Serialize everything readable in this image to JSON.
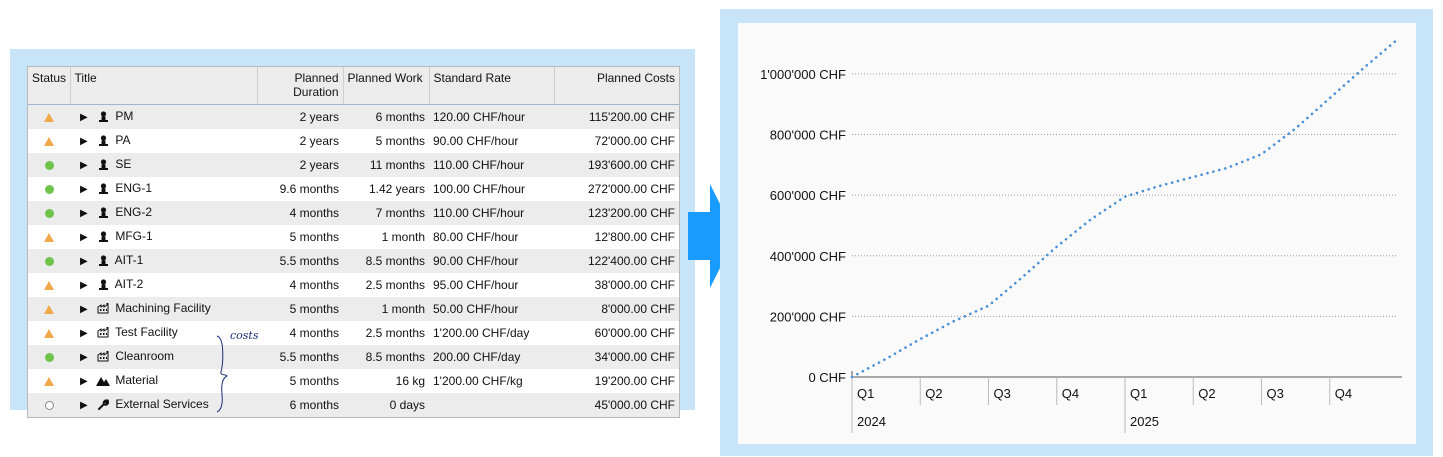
{
  "table": {
    "columns": {
      "status": "Status",
      "title": "Title",
      "planned_duration_l1": "Planned",
      "planned_duration_l2": "Duration",
      "planned_work": "Planned Work",
      "standard_rate": "Standard Rate",
      "planned_costs": "Planned Costs"
    },
    "rows": [
      {
        "status": "warning",
        "icon": "person-icon",
        "title": "PM",
        "duration": "2 years",
        "work": "6 months",
        "rate": "120.00 CHF/hour",
        "costs": "115'200.00 CHF"
      },
      {
        "status": "warning",
        "icon": "person-icon",
        "title": "PA",
        "duration": "2 years",
        "work": "5 months",
        "rate": "90.00 CHF/hour",
        "costs": "72'000.00 CHF"
      },
      {
        "status": "ok",
        "icon": "person-icon",
        "title": "SE",
        "duration": "2 years",
        "work": "11 months",
        "rate": "110.00 CHF/hour",
        "costs": "193'600.00 CHF"
      },
      {
        "status": "ok",
        "icon": "person-icon",
        "title": "ENG-1",
        "duration": "9.6 months",
        "work": "1.42 years",
        "rate": "100.00 CHF/hour",
        "costs": "272'000.00 CHF"
      },
      {
        "status": "ok",
        "icon": "person-icon",
        "title": "ENG-2",
        "duration": "4 months",
        "work": "7 months",
        "rate": "110.00 CHF/hour",
        "costs": "123'200.00 CHF"
      },
      {
        "status": "warning",
        "icon": "person-icon",
        "title": "MFG-1",
        "duration": "5 months",
        "work": "1 month",
        "rate": "80.00 CHF/hour",
        "costs": "12'800.00 CHF"
      },
      {
        "status": "ok",
        "icon": "person-icon",
        "title": "AIT-1",
        "duration": "5.5 months",
        "work": "8.5 months",
        "rate": "90.00 CHF/hour",
        "costs": "122'400.00 CHF"
      },
      {
        "status": "warning",
        "icon": "person-icon",
        "title": "AIT-2",
        "duration": "4 months",
        "work": "2.5 months",
        "rate": "95.00 CHF/hour",
        "costs": "38'000.00 CHF"
      },
      {
        "status": "warning",
        "icon": "factory-icon",
        "title": "Machining Facility",
        "duration": "5 months",
        "work": "1 month",
        "rate": "50.00 CHF/hour",
        "costs": "8'000.00 CHF"
      },
      {
        "status": "warning",
        "icon": "factory-icon",
        "title": "Test Facility",
        "duration": "4 months",
        "work": "2.5 months",
        "rate": "1'200.00 CHF/day",
        "costs": "60'000.00 CHF"
      },
      {
        "status": "ok",
        "icon": "factory-icon",
        "title": "Cleanroom",
        "duration": "5.5 months",
        "work": "8.5 months",
        "rate": "200.00 CHF/day",
        "costs": "34'000.00 CHF"
      },
      {
        "status": "warning",
        "icon": "mountain-icon",
        "title": "Material",
        "duration": "5 months",
        "work": "16 kg",
        "rate": "1'200.00 CHF/kg",
        "costs": "19'200.00 CHF"
      },
      {
        "status": "none",
        "icon": "wrench-icon",
        "title": "External Services",
        "duration": "6 months",
        "work": "0 days",
        "rate": "",
        "costs": "45'000.00 CHF"
      }
    ]
  },
  "annotation": {
    "text": "costs"
  },
  "colors": {
    "panel_bg": "#c8e4f8",
    "arrow": "#1a9bff",
    "status_warning": "#f0a94a",
    "status_ok": "#6fc24a",
    "series": "#4a90d9"
  },
  "chart_data": {
    "type": "line",
    "style": "dotted",
    "y_ticks": [
      "0 CHF",
      "200'000 CHF",
      "400'000 CHF",
      "600'000 CHF",
      "800'000 CHF",
      "1'000'000 CHF"
    ],
    "ylim": [
      0,
      1115200
    ],
    "grid": true,
    "quarters": [
      "Q1",
      "Q2",
      "Q3",
      "Q4",
      "Q1",
      "Q2",
      "Q3",
      "Q4"
    ],
    "years": [
      "2024",
      "2025"
    ],
    "x": [
      0,
      0.5,
      1,
      1.5,
      2,
      2.5,
      3,
      3.5,
      4,
      4.5,
      5,
      5.5,
      6,
      6.5,
      7,
      7.5,
      8
    ],
    "values": [
      0,
      60000,
      125000,
      185000,
      235000,
      330000,
      430000,
      520000,
      595000,
      630000,
      660000,
      690000,
      735000,
      820000,
      920000,
      1020000,
      1115200
    ]
  }
}
